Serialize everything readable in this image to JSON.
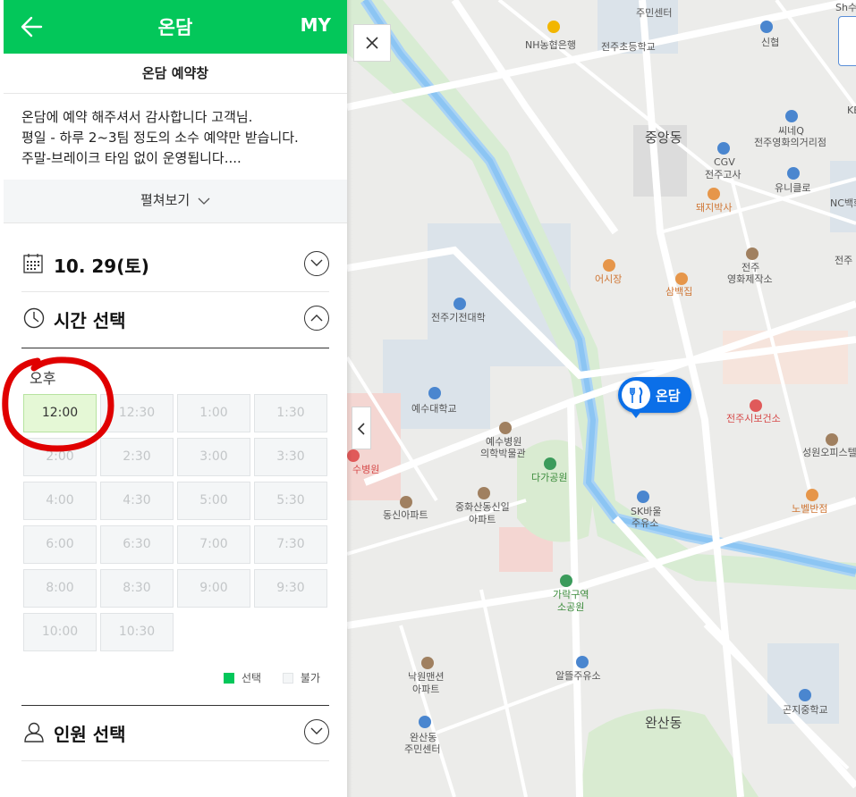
{
  "header": {
    "title": "온담",
    "my_label": "MY"
  },
  "subtitle": "온담 예약창",
  "notice": {
    "lines": [
      "온담에 예약 해주셔서 감사합니다 고객님.",
      "평일 - 하루 2~3팀 정도의 소수 예약만 받습니다.",
      "주말-브레이크 타임 없이 운영됩니다...."
    ],
    "expand_label": "펼쳐보기"
  },
  "date_section": {
    "label": "10. 29(토)"
  },
  "time_section": {
    "label": "시간 선택",
    "period": "오후",
    "slots": [
      "12:00",
      "12:30",
      "1:00",
      "1:30",
      "2:00",
      "2:30",
      "3:00",
      "3:30",
      "4:00",
      "4:30",
      "5:00",
      "5:30",
      "6:00",
      "6:30",
      "7:00",
      "7:30",
      "8:00",
      "8:30",
      "9:00",
      "9:30",
      "10:00",
      "10:30"
    ],
    "selected_slot": "12:00",
    "legend": {
      "selected": "선택",
      "unavailable": "불가"
    }
  },
  "people_section": {
    "label": "인원 선택"
  },
  "colors": {
    "accent": "#03c75a",
    "marker": "#0b6fe8",
    "annotation": "#e00000"
  },
  "map": {
    "marker_label": "온담",
    "labels": {
      "l1": "주민센터",
      "l2": "NH농협은행",
      "l3": "전주초등학교",
      "l4": "신협",
      "l5": "중앙동",
      "l6": "씨네Q",
      "l7": "전주영화의거리점",
      "l8": "CGV",
      "l9": "전주고사",
      "l10": "유니클로",
      "l11": "돼지박사",
      "l12": "어시장",
      "l13": "삼백집",
      "l14": "전주",
      "l15": "영화제작소",
      "l16": "전주기전대학",
      "l17": "예수대학교",
      "l18": "전주시보건소",
      "l19": "예수병원",
      "l20": "의학박물관",
      "l21": "성원오피스텔",
      "l22": "수병원",
      "l23": "다가공원",
      "l24": "중화산동신일",
      "l25": "아파트",
      "l26": "동신아파트",
      "l27": "SK바울",
      "l28": "주유소",
      "l29": "노벨반점",
      "l30": "가락구역",
      "l31": "소공원",
      "l32": "알뜰주유소",
      "l33": "낙원맨션",
      "l34": "아파트",
      "l35": "완산동",
      "l36": "완산동",
      "l37": "주민센터",
      "l38": "곤지중학교",
      "l39": "NC백화",
      "l40": "KE",
      "l41": "Sh수",
      "l42": "전주"
    }
  }
}
